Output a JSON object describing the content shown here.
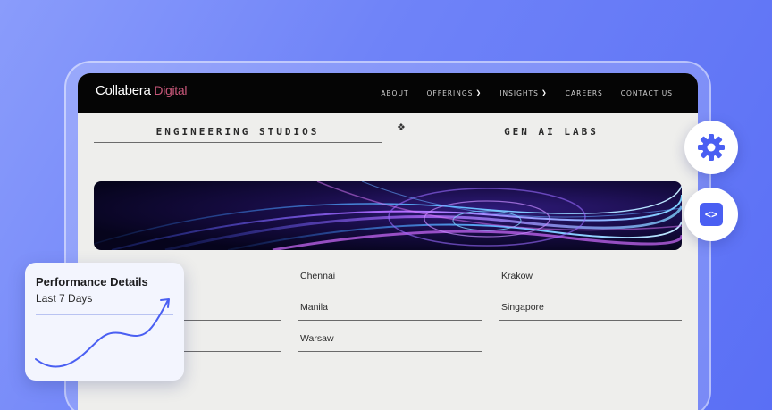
{
  "brand": {
    "name": "Collabera",
    "sub": "Digital"
  },
  "nav": [
    {
      "label": "ABOUT",
      "chevron": false
    },
    {
      "label": "OFFERINGS",
      "chevron": true
    },
    {
      "label": "INSIGHTS",
      "chevron": true
    },
    {
      "label": "CAREERS",
      "chevron": false
    },
    {
      "label": "CONTACT US",
      "chevron": false
    }
  ],
  "sections": {
    "left": "ENGINEERING STUDIOS",
    "right": "GEN AI LABS"
  },
  "cities": [
    [
      "",
      "Chennai",
      "Krakow"
    ],
    [
      "",
      "Manila",
      "Singapore"
    ],
    [
      "",
      "Warsaw",
      ""
    ]
  ],
  "card": {
    "title": "Performance Details",
    "subtitle": "Last 7 Days"
  },
  "icons": {
    "settings": "gear-icon",
    "code": "code-icon",
    "divider": "diamond-icon"
  },
  "colors": {
    "accent": "#4a5ff2",
    "background": "#6f83f8",
    "topbar": "#050505"
  }
}
